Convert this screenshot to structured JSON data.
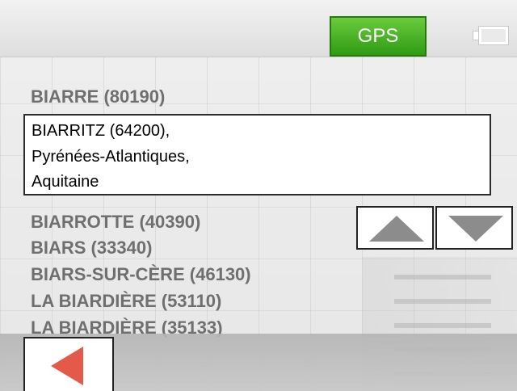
{
  "header": {
    "gps_label": "GPS",
    "battery_icon": "battery-icon"
  },
  "results": {
    "above": "BIARRE (80190)",
    "selected": {
      "line1": "BIARRITZ (64200),",
      "line2": "Pyrénées-Atlantiques,",
      "line3": "Aquitaine"
    },
    "below": [
      "BIARROTTE (40390)",
      "BIARS (33340)",
      "BIARS-SUR-CÈRE (46130)",
      "LA BIARDIÈRE (53110)",
      "LA BIARDIÈRE (35133)"
    ]
  },
  "controls": {
    "scroll_up_icon": "arrow-up-icon",
    "scroll_down_icon": "arrow-down-icon",
    "back_icon": "arrow-left-icon"
  },
  "colors": {
    "gps_green": "#3a9f1a",
    "back_arrow": "#e45a4a",
    "list_text": "#6f6f6f"
  }
}
